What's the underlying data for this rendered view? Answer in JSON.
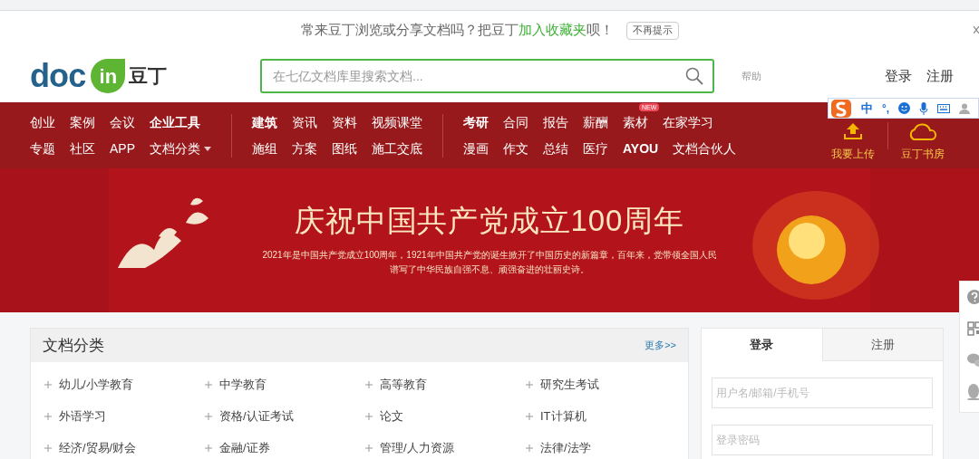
{
  "notice": {
    "before": "常来豆丁浏览或分享文档吗？把豆丁",
    "link": "加入收藏夹",
    "after": "呗！",
    "dismiss": "不再提示"
  },
  "header": {
    "logo_word": "doc",
    "logo_badge": "in",
    "logo_cn": "豆丁",
    "search_placeholder": "在七亿文档库里搜索文档...",
    "help": "帮助",
    "login": "登录",
    "register": "注册"
  },
  "nav": {
    "groups": [
      {
        "rows": [
          [
            {
              "label": "创业",
              "bold": false
            },
            {
              "label": "案例",
              "bold": false
            },
            {
              "label": "会议",
              "bold": false
            },
            {
              "label": "企业工具",
              "bold": true
            }
          ],
          [
            {
              "label": "专题",
              "bold": false
            },
            {
              "label": "社区",
              "bold": false
            },
            {
              "label": "APP",
              "bold": false
            },
            {
              "label": "文档分类",
              "bold": false,
              "dropdown": true
            }
          ]
        ]
      },
      {
        "rows": [
          [
            {
              "label": "建筑",
              "bold": true
            },
            {
              "label": "资讯",
              "bold": false
            },
            {
              "label": "资料",
              "bold": false
            },
            {
              "label": "视频课堂",
              "bold": false
            }
          ],
          [
            {
              "label": "施组",
              "bold": false
            },
            {
              "label": "方案",
              "bold": false
            },
            {
              "label": "图纸",
              "bold": false
            },
            {
              "label": "施工交底",
              "bold": false
            }
          ]
        ]
      },
      {
        "rows": [
          [
            {
              "label": "考研",
              "bold": true
            },
            {
              "label": "合同",
              "bold": false
            },
            {
              "label": "报告",
              "bold": false
            },
            {
              "label": "薪酬",
              "bold": false
            },
            {
              "label": "素材",
              "bold": false,
              "badge": "NEW"
            },
            {
              "label": "在家学习",
              "bold": false
            }
          ],
          [
            {
              "label": "漫画",
              "bold": false
            },
            {
              "label": "作文",
              "bold": false
            },
            {
              "label": "总结",
              "bold": false
            },
            {
              "label": "医疗",
              "bold": false
            },
            {
              "label": "AYOU",
              "bold": true
            },
            {
              "label": "文档合伙人",
              "bold": false
            }
          ]
        ]
      }
    ],
    "actions": [
      {
        "kind": "upload",
        "label": "我要上传"
      },
      {
        "kind": "cloud",
        "label": "豆丁书房"
      }
    ]
  },
  "ime": {
    "mode": "中",
    "punct": "°,"
  },
  "banner": {
    "title": "庆祝中国共产党成立100周年",
    "lines": [
      "2021年是中国共产党成立100周年，1921年中国共产党的诞生掀开了中国历史的新篇章，百年来，党带领全国人民",
      "谱写了中华民族自强不息、顽强奋进的壮丽史诗。"
    ]
  },
  "categories": {
    "title": "文档分类",
    "more": "更多>>",
    "items": [
      "幼儿/小学教育",
      "中学教育",
      "高等教育",
      "研究生考试",
      "外语学习",
      "资格/认证考试",
      "论文",
      "IT计算机",
      "经济/贸易/财会",
      "金融/证券",
      "管理/人力资源",
      "法律/法学"
    ]
  },
  "login_panel": {
    "tabs": [
      {
        "label": "登录",
        "selected": true
      },
      {
        "label": "注册",
        "selected": false
      }
    ],
    "fields": [
      {
        "placeholder": "用户名/邮箱/手机号"
      },
      {
        "placeholder": "登录密码"
      }
    ]
  }
}
